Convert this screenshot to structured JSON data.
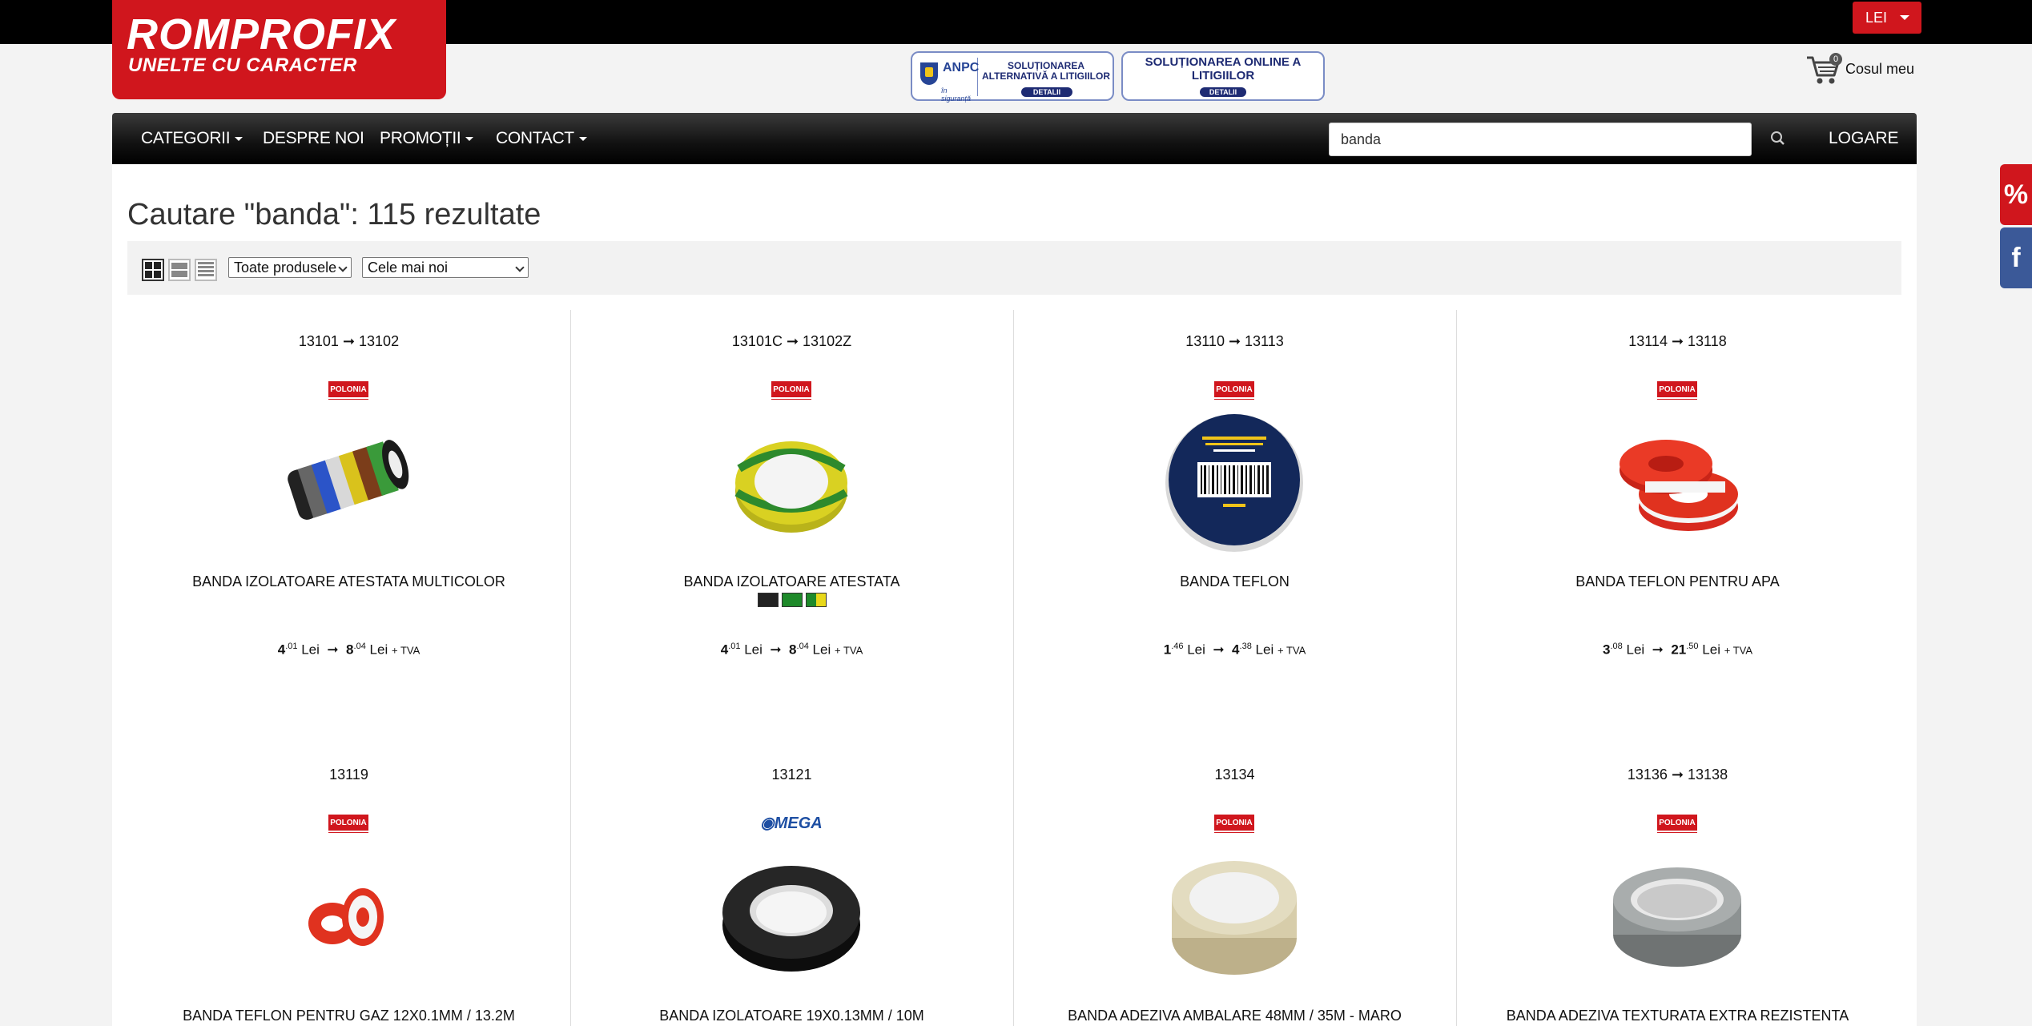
{
  "header": {
    "currency": "LEI",
    "logo": {
      "line1": "ROMPROFIX",
      "line2": "UNELTE CU CARACTER"
    },
    "badge_sal": {
      "org": "ANPC",
      "org_sub": "în siguranță",
      "text": "SOLUȚIONAREA ALTERNATIVĂ A LITIGIILOR",
      "button": "DETALII"
    },
    "badge_sol": {
      "text": "SOLUȚIONAREA ONLINE A LITIGIILOR",
      "button": "DETALII"
    },
    "cart": {
      "count": "0",
      "label": "Cosul meu"
    }
  },
  "nav": {
    "items": [
      "CATEGORII",
      "DESPRE NOI",
      "PROMOȚII",
      "CONTACT"
    ],
    "search_value": "banda",
    "login": "LOGARE"
  },
  "results": {
    "title": "Cautare \"banda\": 115 rezultate",
    "filter_select": "Toate produsele",
    "sort_select": "Cele mai noi"
  },
  "products": [
    {
      "code": "13101 ➞ 13102",
      "brand": "POLONIA",
      "name": "BANDA IZOLATOARE ATESTATA MULTICOLOR",
      "price_min_int": "4",
      "price_min_dec": ".01",
      "price_max_int": "8",
      "price_max_dec": ".04",
      "currency": "Lei",
      "tva": "+ TVA"
    },
    {
      "code": "13101C ➞ 13102Z",
      "brand": "POLONIA",
      "name": "BANDA IZOLATOARE ATESTATA",
      "price_min_int": "4",
      "price_min_dec": ".01",
      "price_max_int": "8",
      "price_max_dec": ".04",
      "currency": "Lei",
      "tva": "+ TVA"
    },
    {
      "code": "13110 ➞ 13113",
      "brand": "POLONIA",
      "name": "BANDA TEFLON",
      "price_min_int": "1",
      "price_min_dec": ".46",
      "price_max_int": "4",
      "price_max_dec": ".38",
      "currency": "Lei",
      "tva": "+ TVA"
    },
    {
      "code": "13114 ➞ 13118",
      "brand": "POLONIA",
      "name": "BANDA TEFLON PENTRU APA",
      "price_min_int": "3",
      "price_min_dec": ".08",
      "price_max_int": "21",
      "price_max_dec": ".50",
      "currency": "Lei",
      "tva": "+ TVA"
    },
    {
      "code": "13119",
      "brand": "POLONIA",
      "name": "BANDA TEFLON PENTRU GAZ 12X0.1MM / 13.2M"
    },
    {
      "code": "13121",
      "brand": "MEGA",
      "name": "BANDA IZOLATOARE 19X0.13MM / 10M"
    },
    {
      "code": "13134",
      "brand": "POLONIA",
      "name": "BANDA ADEZIVA AMBALARE 48MM / 35M - MARO"
    },
    {
      "code": "13136 ➞ 13138",
      "brand": "POLONIA",
      "name": "BANDA ADEZIVA TEXTURATA EXTRA REZISTENTA"
    }
  ],
  "swatch_colors": [
    "#222222",
    "#1e8a2a",
    "#e8d81a"
  ],
  "colors": {
    "brand_red": "#d0161d",
    "badge_blue": "#1e2b73",
    "facebook": "#3b5998"
  },
  "side": {
    "discount": "%",
    "facebook": "f"
  }
}
